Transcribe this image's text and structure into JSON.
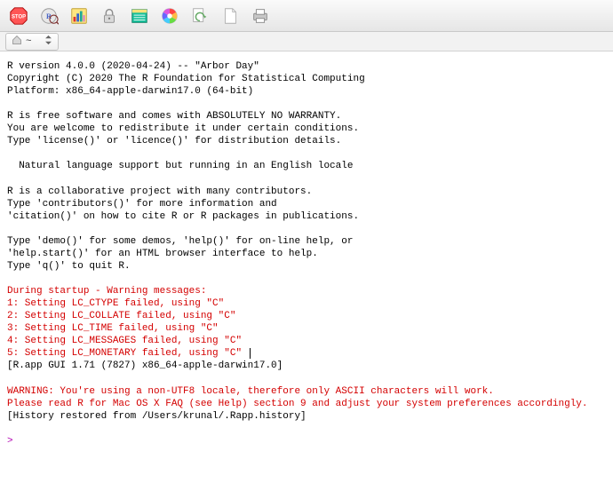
{
  "toolbar": {
    "icons": [
      "stop-icon",
      "r-debug-icon",
      "bar-chart-icon",
      "lock-icon",
      "list-icon",
      "color-wheel-icon",
      "reload-icon",
      "page-icon",
      "print-icon"
    ]
  },
  "pathbar": {
    "label": "~"
  },
  "console": {
    "lines": [
      {
        "t": "R version 4.0.0 (2020-04-24) -- \"Arbor Day\"",
        "c": "normal"
      },
      {
        "t": "Copyright (C) 2020 The R Foundation for Statistical Computing",
        "c": "normal"
      },
      {
        "t": "Platform: x86_64-apple-darwin17.0 (64-bit)",
        "c": "normal"
      },
      {
        "t": "",
        "c": "blank"
      },
      {
        "t": "R is free software and comes with ABSOLUTELY NO WARRANTY.",
        "c": "normal"
      },
      {
        "t": "You are welcome to redistribute it under certain conditions.",
        "c": "normal"
      },
      {
        "t": "Type 'license()' or 'licence()' for distribution details.",
        "c": "normal"
      },
      {
        "t": "",
        "c": "blank"
      },
      {
        "t": "  Natural language support but running in an English locale",
        "c": "normal"
      },
      {
        "t": "",
        "c": "blank"
      },
      {
        "t": "R is a collaborative project with many contributors.",
        "c": "normal"
      },
      {
        "t": "Type 'contributors()' for more information and",
        "c": "normal"
      },
      {
        "t": "'citation()' on how to cite R or R packages in publications.",
        "c": "normal"
      },
      {
        "t": "",
        "c": "blank"
      },
      {
        "t": "Type 'demo()' for some demos, 'help()' for on-line help, or",
        "c": "normal"
      },
      {
        "t": "'help.start()' for an HTML browser interface to help.",
        "c": "normal"
      },
      {
        "t": "Type 'q()' to quit R.",
        "c": "normal"
      },
      {
        "t": "",
        "c": "blank"
      },
      {
        "t": "During startup - Warning messages:",
        "c": "red"
      },
      {
        "t": "1: Setting LC_CTYPE failed, using \"C\" ",
        "c": "red"
      },
      {
        "t": "2: Setting LC_COLLATE failed, using \"C\" ",
        "c": "red"
      },
      {
        "t": "3: Setting LC_TIME failed, using \"C\" ",
        "c": "red"
      },
      {
        "t": "4: Setting LC_MESSAGES failed, using \"C\" ",
        "c": "red"
      },
      {
        "t": "5: Setting LC_MONETARY failed, using \"C\" ",
        "c": "red",
        "cursor": true
      },
      {
        "t": "[R.app GUI 1.71 (7827) x86_64-apple-darwin17.0]",
        "c": "normal"
      },
      {
        "t": "",
        "c": "blank"
      },
      {
        "t": "WARNING: You're using a non-UTF8 locale, therefore only ASCII characters will work.",
        "c": "red"
      },
      {
        "t": "Please read R for Mac OS X FAQ (see Help) section 9 and adjust your system preferences accordingly.",
        "c": "red"
      },
      {
        "t": "[History restored from /Users/krunal/.Rapp.history]",
        "c": "normal"
      },
      {
        "t": "",
        "c": "blank"
      },
      {
        "t": "> ",
        "c": "violet"
      }
    ]
  }
}
